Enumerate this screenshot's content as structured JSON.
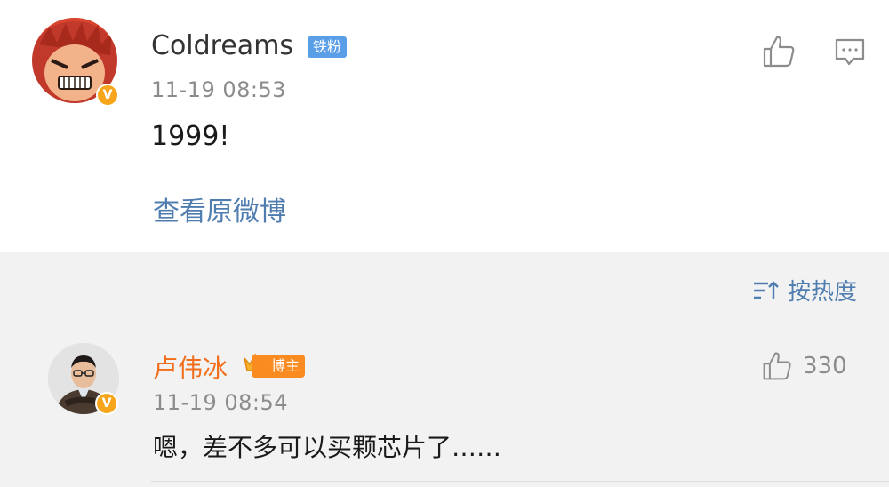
{
  "post": {
    "username": "Coldreams",
    "badge": "铁粉",
    "time": "11-19 08:53",
    "text": "1999!",
    "view_original": "查看原微博",
    "verified_mark": "V"
  },
  "sort": {
    "label": "按热度"
  },
  "comments": [
    {
      "username": "卢伟冰",
      "badge": "博主",
      "time": "11-19 08:54",
      "text": "嗯，差不多可以买颗芯片了……",
      "likes": "330",
      "verified_mark": "V"
    }
  ],
  "colors": {
    "link": "#507daf",
    "username_highlight": "#f26d1a",
    "verified_badge": "#f7a61c",
    "fan_badge": "#5b9ee8",
    "host_badge": "#f98b21"
  },
  "icons": [
    "thumbs-up-icon",
    "comment-icon",
    "sort-icon",
    "crown-icon"
  ]
}
